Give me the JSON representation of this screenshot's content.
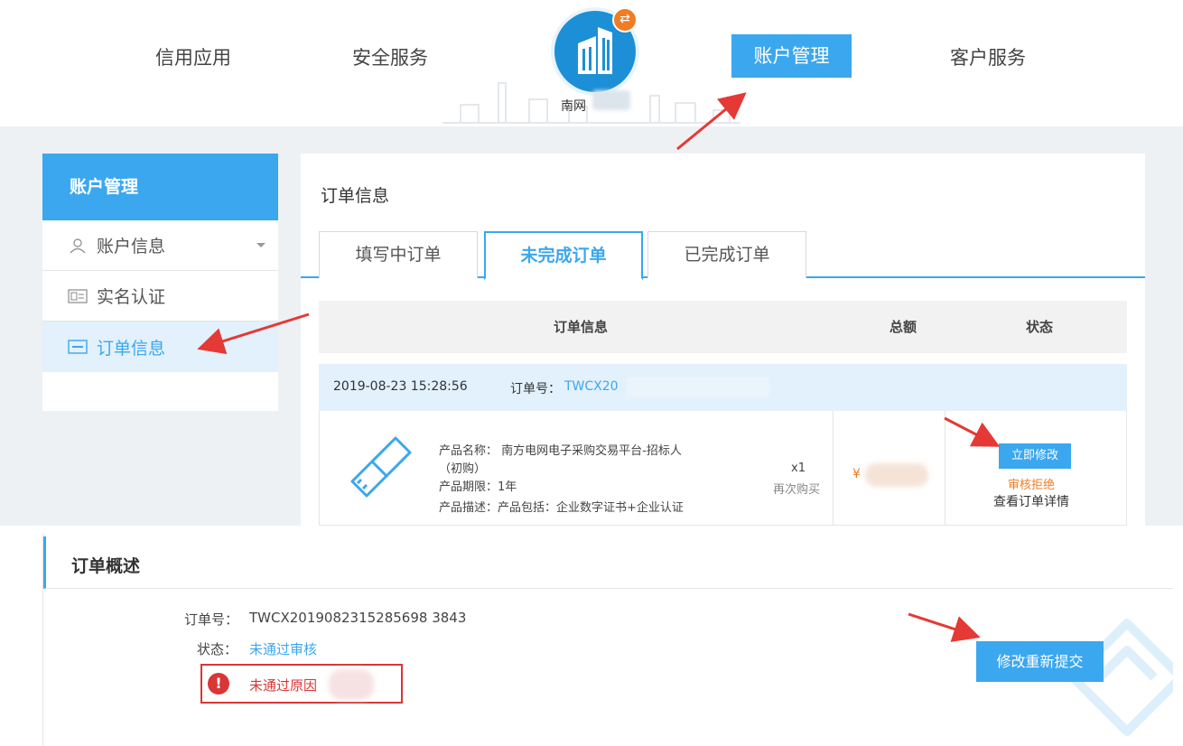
{
  "nav": {
    "items": [
      "信用应用",
      "安全服务",
      "账户管理",
      "客户服务"
    ],
    "logo_caption": "南网"
  },
  "sidebar": {
    "title": "账户管理",
    "items": [
      {
        "label": "账户信息"
      },
      {
        "label": "实名认证"
      },
      {
        "label": "订单信息"
      }
    ]
  },
  "content": {
    "title": "订单信息",
    "tabs": [
      "填写中订单",
      "未完成订单",
      "已完成订单"
    ],
    "columns": [
      "订单信息",
      "总额",
      "状态"
    ],
    "order": {
      "time": "2019-08-23 15:28:56",
      "no_label": "订单号：",
      "no_value": "TWCX20",
      "product_name_1": "产品名称：  南方电网电子采购交易平台-招标人",
      "product_name_2": "（初购）",
      "product_period": "产品期限：1年",
      "product_desc": "产品描述：产品包括：企业数字证书+企业认证",
      "qty": "x1",
      "rebuy": "再次购买",
      "price_symbol": "¥",
      "modify_now": "立即修改",
      "review_status": "审核拒绝",
      "view_detail": "查看订单详情"
    }
  },
  "summary": {
    "title": "订单概述",
    "no_label": "订单号：",
    "no_value": "TWCX2019082315285698 3843",
    "status_label": "状态：",
    "status_value": "未通过审核",
    "reason_icon": "!",
    "reason_text": "未通过原因",
    "resubmit": "修改重新提交"
  },
  "colors": {
    "accent": "#3ba7ee",
    "warning": "#f07d23",
    "error": "#d93636",
    "arrow": "#e53935"
  }
}
